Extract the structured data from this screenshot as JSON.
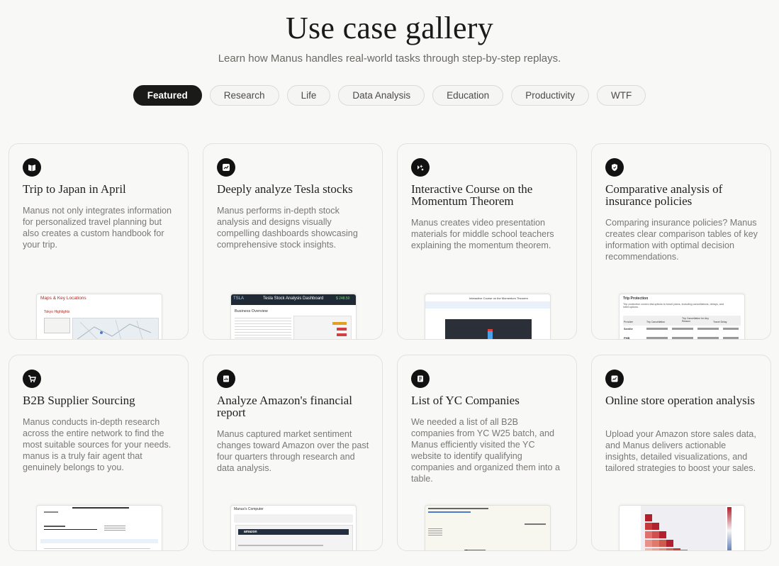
{
  "header": {
    "title": "Use case gallery",
    "subtitle": "Learn how Manus handles real-world tasks through step-by-step replays."
  },
  "tabs": [
    {
      "label": "Featured",
      "active": true
    },
    {
      "label": "Research",
      "active": false
    },
    {
      "label": "Life",
      "active": false
    },
    {
      "label": "Data Analysis",
      "active": false
    },
    {
      "label": "Education",
      "active": false
    },
    {
      "label": "Productivity",
      "active": false
    },
    {
      "label": "WTF",
      "active": false
    }
  ],
  "cards": [
    {
      "icon": "book-icon",
      "title": "Trip to Japan in April",
      "description": "Manus not only integrates information for personalized travel planning but also creates a custom handbook for your trip.",
      "thumb_heading": "Maps & Key Locations",
      "thumb_sub": "Tokyo Highlights"
    },
    {
      "icon": "chart-icon",
      "title": "Deeply analyze Tesla stocks",
      "description": "Manus performs in-depth stock analysis and designs visually compelling dashboards showcasing comprehensive stock insights.",
      "thumb_heading": "Tesla Stock Analysis Dashboard",
      "thumb_sub": "TSLA",
      "thumb_price": "$ 248.50",
      "thumb_section": "Business Overview"
    },
    {
      "icon": "sparkle-icon",
      "title": "Interactive Course on the Momentum Theorem",
      "description": "Manus creates video presentation materials for middle school teachers explaining the momentum theorem.",
      "thumb_heading": "Interactive Course on the Momentum Theorem"
    },
    {
      "icon": "shield-icon",
      "title": "Comparative analysis of insurance policies",
      "description": "Comparing insurance policies? Manus creates clear comparison tables of key information with optimal decision recommendations.",
      "thumb_heading": "Trip Protection",
      "thumb_sub": "Trip protection covers disruptions to travel plans, including cancellations, delays, and interruptions.",
      "thumb_cols": [
        "Provider",
        "Trip Cancellation",
        "Trip Cancellation for Any Reason",
        "Travel Delay"
      ],
      "thumb_rows": [
        "Seville",
        "PHB"
      ]
    },
    {
      "icon": "cart-icon",
      "title": "B2B Supplier Sourcing",
      "description": "Manus conducts in-depth research across the entire network to find the most suitable sources for your needs. manus is a truly fair agent that genuinely belongs to you."
    },
    {
      "icon": "report-icon",
      "title": "Analyze Amazon's financial report",
      "description": "Manus captured market sentiment changes toward Amazon over the past four quarters through research and data analysis.",
      "thumb_heading": "Manus's Computer",
      "thumb_sub": "amazon"
    },
    {
      "icon": "list-icon",
      "title": "List of YC Companies",
      "description": "We needed a list of all B2B companies from YC W25 batch, and Manus efficiently visited the YC website to identify qualifying companies and organized them into a table."
    },
    {
      "icon": "store-icon",
      "title": "Online store operation analysis",
      "description": "Upload your Amazon store sales data, and Manus delivers actionable insights, detailed visualizations, and tailored strategies to boost your sales."
    }
  ]
}
